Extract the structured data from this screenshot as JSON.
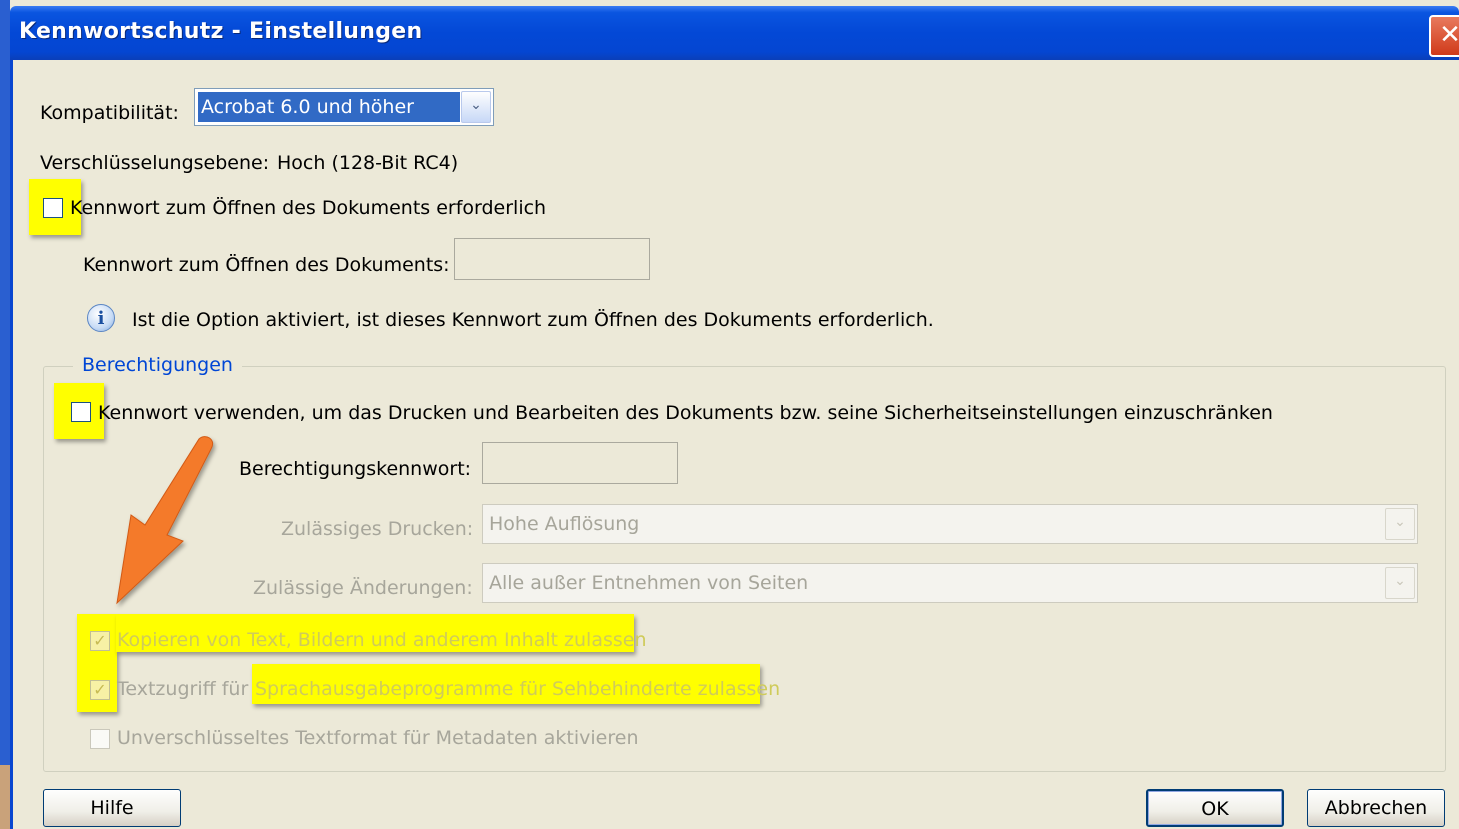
{
  "window": {
    "title": "Kennwortschutz - Einstellungen",
    "close_glyph": "✕"
  },
  "compat": {
    "label": "Kompatibilität:",
    "value": "Acrobat 6.0 und höher"
  },
  "encryption": {
    "label": "Verschlüsselungsebene:",
    "value": "Hoch (128-Bit RC4)"
  },
  "open_password": {
    "checkbox_label": "Kennwort zum Öffnen des Dokuments erforderlich",
    "field_label": "Kennwort zum Öffnen des Dokuments:",
    "info": "Ist die Option aktiviert, ist dieses Kennwort zum Öffnen des Dokuments erforderlich."
  },
  "permissions": {
    "group_label": "Berechtigungen",
    "checkbox_label": "Kennwort verwenden, um das Drucken und Bearbeiten des Dokuments bzw. seine Sicherheitseinstellungen einzuschränken",
    "password_label": "Berechtigungskennwort:",
    "print_label": "Zulässiges Drucken:",
    "print_value": "Hohe Auflösung",
    "changes_label": "Zulässige Änderungen:",
    "changes_value": "Alle außer Entnehmen von Seiten",
    "copy_label": "Kopieren von Text, Bildern und anderem Inhalt zulassen",
    "access_label_a": "Textzugriff für ",
    "access_label_b": "Sprachausgabeprogramme für Sehbehinderte zulassen",
    "metadata_label": "Unverschlüsseltes Textformat für Metadaten aktivieren"
  },
  "buttons": {
    "help": "Hilfe",
    "ok": "OK",
    "cancel": "Abbrechen"
  },
  "icons": {
    "dropdown": "chevron-down-icon",
    "info": "info-icon",
    "check": "✓",
    "info_glyph": "i",
    "chevron_glyph": "⌄"
  },
  "colors": {
    "highlight": "#ffff00",
    "arrow": "#f47a2c",
    "title_bar": "#0348d6",
    "selection": "#316ac5"
  }
}
